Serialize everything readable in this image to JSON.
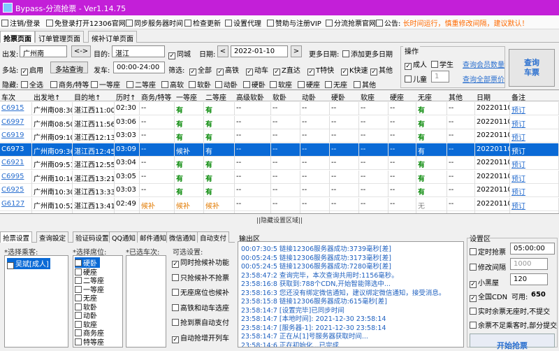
{
  "window": {
    "title": "Bypass-分流抢票 - Ver1.14.75"
  },
  "menu": [
    {
      "label": "注销/登录"
    },
    {
      "label": "免登录打开12306官网"
    },
    {
      "label": "同步服务器时间"
    },
    {
      "label": "检查更新"
    },
    {
      "label": "设置代理"
    },
    {
      "label": "赞助与注册VIP"
    },
    {
      "label": "分流抢票官网"
    }
  ],
  "notice": {
    "label": "公告:",
    "text": "长时间运行，慎重修改间隔，建议默认！"
  },
  "tabs": [
    "抢票页面",
    "订单管理页面",
    "候补订单页面"
  ],
  "query": {
    "from_label": "出发:",
    "from": "广州南",
    "swap": "<->",
    "to_label": "目的:",
    "to": "湛江",
    "same_city": "同城",
    "date_label": "日期:",
    "date": "2022-01-10",
    "prev": "<",
    "next": ">",
    "more_dates": "更多日期:",
    "add_more_dates": "添加更多日期",
    "multi_station": "多站:",
    "enable": "启用",
    "multi_query": "多站查询",
    "depart_label": "发车:",
    "depart_range": "00:00-24:00",
    "filter_label": "筛选:",
    "filters": [
      "全部",
      "高铁",
      "动车",
      "Z直达",
      "T特快",
      "K快速",
      "其他"
    ],
    "hide_label": "隐藏:",
    "hides": [
      "全选",
      "商务/特等",
      "一等座",
      "二等座",
      "高软",
      "软卧",
      "动卧",
      "硬卧",
      "软座",
      "硬座",
      "无座",
      "其他"
    ],
    "ops_title": "操作",
    "adult": "成人",
    "student": "学生",
    "child": "儿童",
    "child_count": "1",
    "member_link": "查询会员数量",
    "all_fares_link": "查询全部票价",
    "query_btn_l1": "查询",
    "query_btn_l2": "车票"
  },
  "table": {
    "headers": [
      "车次",
      "出发地↑",
      "目的地↑",
      "历时↑",
      "商务/特等",
      "一等座",
      "二等座",
      "高级软卧",
      "软卧",
      "动卧",
      "硬卧",
      "软座",
      "硬座",
      "无座",
      "其他",
      "日期",
      "备注"
    ],
    "rows": [
      {
        "c": [
          "C6915",
          "广州南08:30",
          "湛江西11:00",
          "02:30",
          "--",
          "有",
          "有",
          "--",
          "--",
          "--",
          "--",
          "--",
          "--",
          "有",
          "--",
          "20220110",
          "预订"
        ],
        "sel": false,
        "o": []
      },
      {
        "c": [
          "C6997",
          "广州南08:50",
          "湛江西11:56",
          "03:06",
          "--",
          "有",
          "有",
          "--",
          "--",
          "--",
          "--",
          "--",
          "--",
          "有",
          "--",
          "20220110",
          "预订"
        ],
        "sel": false,
        "o": []
      },
      {
        "c": [
          "C6919",
          "广州南09:10",
          "湛江西12:13",
          "03:03",
          "--",
          "有",
          "有",
          "--",
          "--",
          "--",
          "--",
          "--",
          "--",
          "有",
          "--",
          "20220110",
          "预订"
        ],
        "sel": false,
        "o": []
      },
      {
        "c": [
          "C6973",
          "广州南09:36",
          "湛江西12:45",
          "03:09",
          "--",
          "候补",
          "有",
          "--",
          "--",
          "--",
          "--",
          "--",
          "--",
          "有",
          "--",
          "20220110",
          "预订"
        ],
        "sel": true,
        "o": []
      },
      {
        "c": [
          "C6921",
          "广州南09:51",
          "湛江西12:55",
          "03:04",
          "--",
          "有",
          "有",
          "--",
          "--",
          "--",
          "--",
          "--",
          "--",
          "有",
          "--",
          "20220110",
          "预订"
        ],
        "sel": false,
        "o": []
      },
      {
        "c": [
          "C6995",
          "广州南10:16",
          "湛江西13:21",
          "03:05",
          "--",
          "有",
          "有",
          "--",
          "--",
          "--",
          "--",
          "--",
          "--",
          "有",
          "--",
          "20220110",
          "预订"
        ],
        "sel": false,
        "o": []
      },
      {
        "c": [
          "C6925",
          "广州南10:30",
          "湛江西13:33",
          "03:03",
          "--",
          "有",
          "有",
          "--",
          "--",
          "--",
          "--",
          "--",
          "--",
          "有",
          "--",
          "20220110",
          "预订"
        ],
        "sel": false,
        "o": []
      },
      {
        "c": [
          "G6127",
          "广州南10:52",
          "湛江西13:41",
          "02:49",
          "候补",
          "候补",
          "候补",
          "--",
          "--",
          "--",
          "--",
          "--",
          "--",
          "无",
          "--",
          "20220110",
          "预订"
        ],
        "sel": false,
        "o": [
          4,
          5,
          6
        ]
      },
      {
        "c": [
          "C6927",
          "广州南11:15",
          "湛江西14:06",
          "02:51",
          "--",
          "有",
          "有",
          "--",
          "--",
          "--",
          "--",
          "--",
          "--",
          "有",
          "--",
          "20220110",
          "预订"
        ],
        "sel": false,
        "o": []
      }
    ]
  },
  "hide_settings_bar": "||隐藏设置区域||",
  "bottom_tabs": [
    "抢票设置",
    "查询設定",
    "验证码设置",
    "QQ通知",
    "邮件通知",
    "微信通知",
    "自动支付"
  ],
  "passenger": {
    "title": "*选择乘客:",
    "items": [
      "吴斌[成人]"
    ]
  },
  "seats": {
    "title": "*选择席位:",
    "items": [
      "硬卧",
      "硬座",
      "二等座",
      "一等座",
      "无座",
      "软卧",
      "动卧",
      "软座",
      "商务座",
      "特等座"
    ]
  },
  "selected_trains": {
    "title": "*已选车次:"
  },
  "options": {
    "title": "可选设置:",
    "items": [
      {
        "label": "同时抢候补功能",
        "checked": true
      },
      {
        "label": "只抢候补不抢票",
        "checked": false
      },
      {
        "label": "无座席位也候补",
        "checked": false
      },
      {
        "label": "高铁和动车选座",
        "checked": false
      },
      {
        "label": "抢到票自动支付",
        "checked": false
      },
      {
        "label": "自动抢增开列车",
        "checked": true
      }
    ]
  },
  "output": {
    "title": "输出区",
    "lines": [
      "00:07:30:5 链接12306服务器成功:3739毫秒[差]",
      "00:05:24:5 链接12306服务器成功:3173毫秒[差]",
      "00:05:24:5 链接12306服务器成功:7280毫秒[差]",
      "23:58:47:2 查询完毕，本次查询共用时:1156毫秒。",
      "23:58:16:8 获取到:788个CDN,开始智能筛选中...",
      "23:58:16:3 您还没有绑定微信通知，建议绑定微信通知，接受消息。",
      "23:58:15:8 链接12306服务器成功:615毫秒[差]",
      "23:58:14:7 [设置完毕]已同步时间",
      "23:58:14:7 [本地时间]: 2021-12-30 23:58:14",
      "23:58:14:7 [服务器-1]: 2021-12-30 23:58:14",
      "23:58:14:7 正在从[1]号服务器获取时间...",
      "23:58:14:6 正在初始化...已完成"
    ]
  },
  "settings": {
    "title": "设置区",
    "timed": "定时抢票",
    "timed_value": "05:00:00",
    "interval": "修改间隔",
    "interval_value": "1000",
    "small_black": "小黑屋",
    "small_black_value": "120",
    "all_cdn": "全国CDN",
    "available_label": "可用:",
    "available_value": "650",
    "real_seat": "实时余票无座时,不提交",
    "insufficient": "余票不足乘客时,部分提交",
    "start": "开始抢票"
  }
}
